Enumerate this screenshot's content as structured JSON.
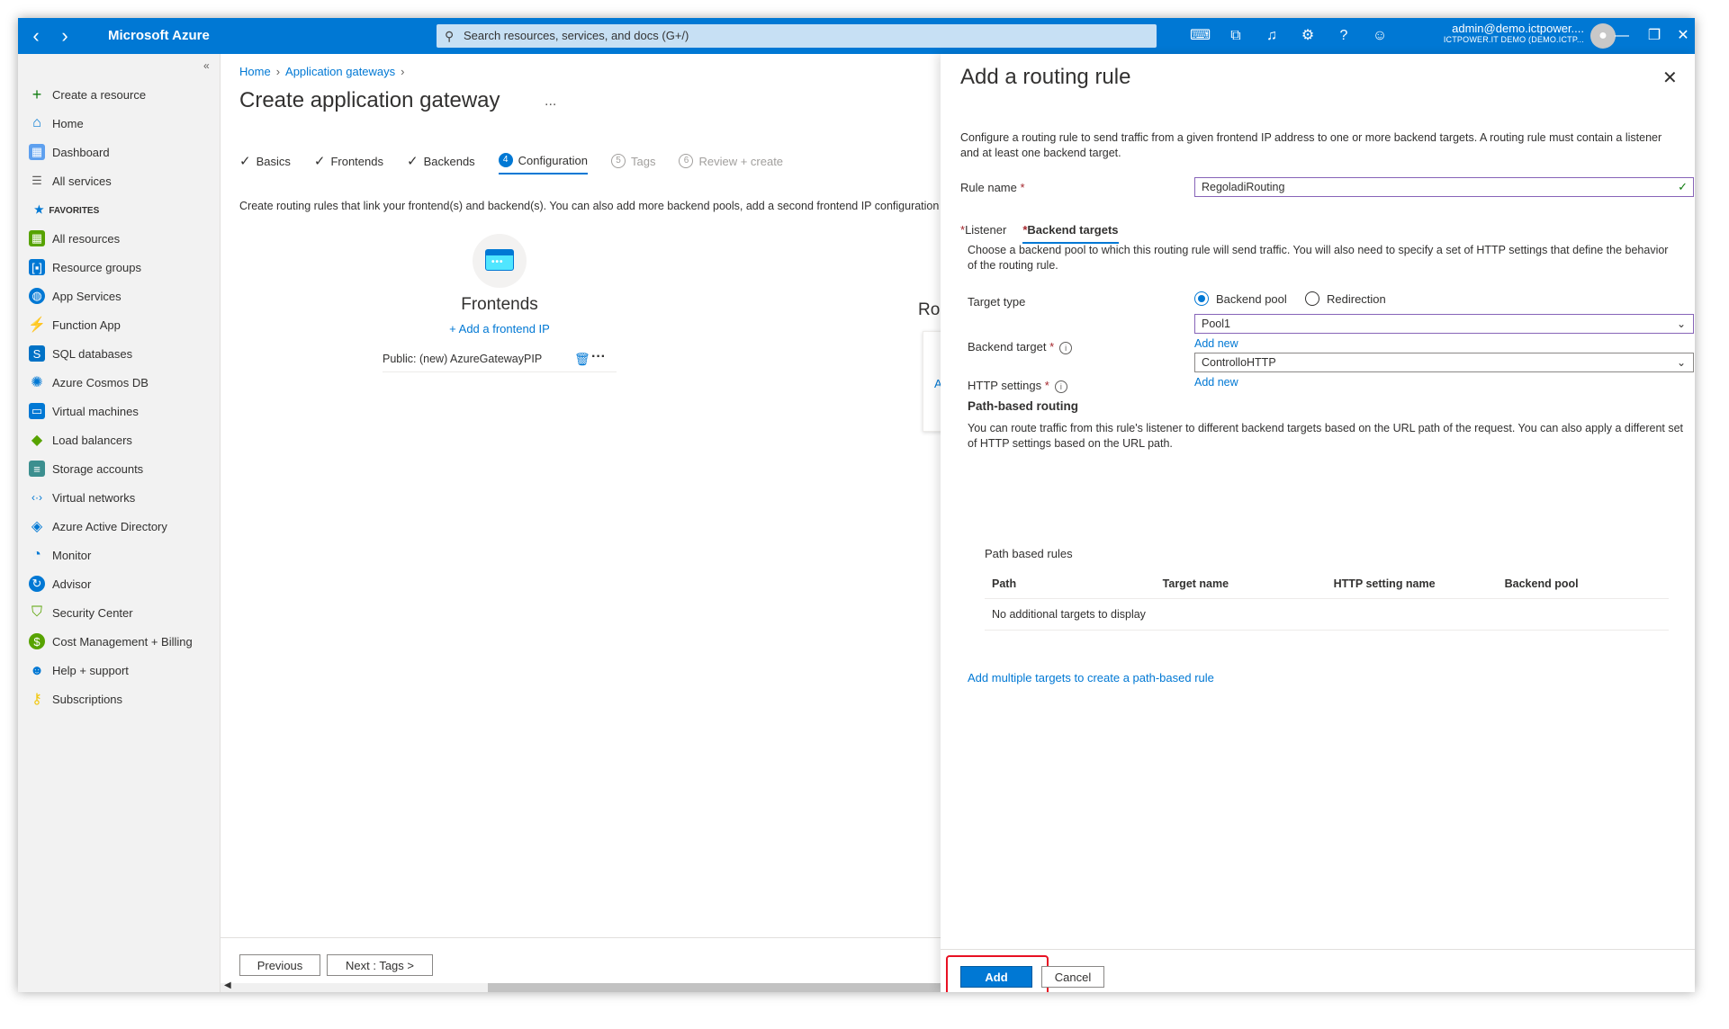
{
  "topbar": {
    "brand": "Microsoft Azure",
    "search_placeholder": "Search resources, services, and docs (G+/)",
    "account_user": "admin@demo.ictpower....",
    "account_tenant": "ICTPOWER.IT DEMO (DEMO.ICTP..."
  },
  "sidebar": {
    "create": "Create a resource",
    "home": "Home",
    "dashboard": "Dashboard",
    "all_services": "All services",
    "favorites_header": "FAVORITES",
    "items": [
      "All resources",
      "Resource groups",
      "App Services",
      "Function App",
      "SQL databases",
      "Azure Cosmos DB",
      "Virtual machines",
      "Load balancers",
      "Storage accounts",
      "Virtual networks",
      "Azure Active Directory",
      "Monitor",
      "Advisor",
      "Security Center",
      "Cost Management + Billing",
      "Help + support",
      "Subscriptions"
    ]
  },
  "main": {
    "breadcrumb": [
      "Home",
      "Application gateways"
    ],
    "title": "Create application gateway",
    "more": "...",
    "tabs": {
      "basics": "Basics",
      "frontends": "Frontends",
      "backends": "Backends",
      "configuration_num": "4",
      "configuration": "Configuration",
      "tags_num": "5",
      "tags": "Tags",
      "review_num": "6",
      "review": "Review + create"
    },
    "description": "Create routing rules that link your frontend(s) and backend(s). You can also add more backend pools, add a second frontend IP configuration if you haven't already, or edit previous configurations.",
    "frontends_title": "Frontends",
    "add_frontend": "+ Add a frontend IP",
    "frontend_item": "Public: (new) AzureGatewayPIP",
    "routing_partial": "Ro",
    "routing_link_partial": "A",
    "previous_button": "Previous",
    "next_button": "Next : Tags >"
  },
  "panel": {
    "title": "Add a routing rule",
    "description": "Configure a routing rule to send traffic from a given frontend IP address to one or more backend targets. A routing rule must contain a listener and at least one backend target.",
    "rule_name_label": "Rule name",
    "rule_name_value": "RegoladiRouting",
    "tab_listener": "Listener",
    "tab_backend": "Backend targets",
    "backend_desc": "Choose a backend pool to which this routing rule will send traffic. You will also need to specify a set of HTTP settings that define the behavior of the routing rule.",
    "target_type_label": "Target type",
    "radio_backend_pool": "Backend pool",
    "radio_redirection": "Redirection",
    "backend_target_label": "Backend target",
    "backend_target_value": "Pool1",
    "add_new_1": "Add new",
    "http_settings_label": "HTTP settings",
    "http_settings_value": "ControlloHTTP",
    "add_new_2": "Add new",
    "path_routing_title": "Path-based routing",
    "path_routing_desc": "You can route traffic from this rule's listener to different backend targets based on the URL path of the request. You can also apply a different set of HTTP settings based on the URL path.",
    "path_rules_caption": "Path based rules",
    "columns": [
      "Path",
      "Target name",
      "HTTP setting name",
      "Backend pool"
    ],
    "empty_text": "No additional targets to display",
    "add_multiple_link": "Add multiple targets to create a path-based rule",
    "add_button": "Add",
    "cancel_button": "Cancel"
  },
  "colors": {
    "accent": "#0078d4",
    "highlight": "#e81123"
  }
}
